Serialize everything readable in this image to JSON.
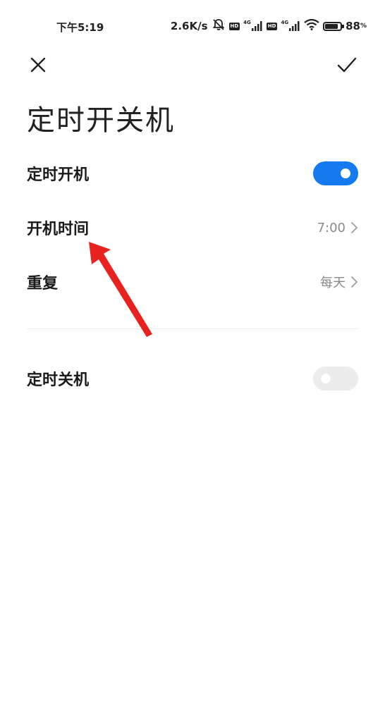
{
  "status_bar": {
    "time": "下午5:19",
    "net_speed": "2.6K/s",
    "sim1": {
      "badge": "HD",
      "type": "4G"
    },
    "sim2": {
      "badge": "HD",
      "type": "4G"
    },
    "battery_level": "88",
    "battery_unit": "%",
    "battery_fraction": 0.88
  },
  "header": {
    "close_icon": "close-icon",
    "confirm_icon": "check-icon"
  },
  "page": {
    "title": "定时开关机"
  },
  "settings": {
    "power_on": {
      "label": "定时开机",
      "enabled": true
    },
    "power_on_time": {
      "label": "开机时间",
      "value": "7:00"
    },
    "repeat": {
      "label": "重复",
      "value": "每天"
    },
    "power_off": {
      "label": "定时关机",
      "enabled": false
    }
  },
  "colors": {
    "accent": "#1579f0",
    "toggle_off": "#ececec",
    "secondary_text": "#8a8a8a",
    "annotation_arrow": "#e8231f"
  }
}
